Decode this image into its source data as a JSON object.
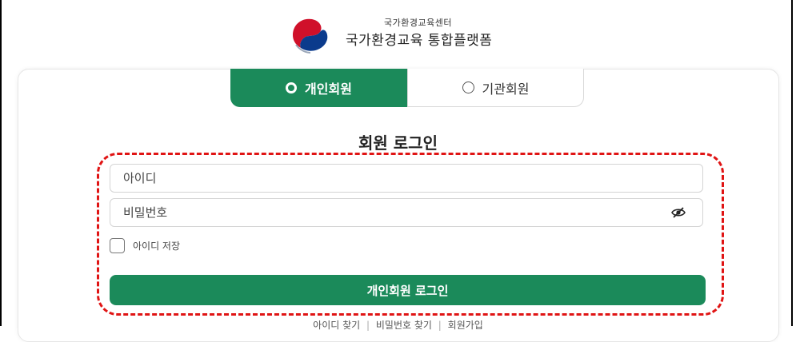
{
  "header": {
    "org_name": "국가환경교육센터",
    "platform_name": "국가환경교육 통합플랫폼",
    "logo_icon": "korean-government-taegeuk-logo",
    "logo_colors": {
      "red": "#d0102a",
      "blue": "#0b3b8c"
    }
  },
  "tabs": [
    {
      "label": "개인회원",
      "selected": true
    },
    {
      "label": "기관회원",
      "selected": false
    }
  ],
  "login": {
    "title": "회원 로그인",
    "id_placeholder": "아이디",
    "pw_placeholder": "비밀번호",
    "show_password_icon": "eye-slash-icon",
    "remember_label": "아이디 저장",
    "remember_checked": false,
    "submit_label": "개인회원 로그인"
  },
  "footer_links": {
    "find_id": "아이디 찾기",
    "find_pw": "비밀번호 찾기",
    "signup": "회원가입",
    "separator": "|"
  },
  "colors": {
    "primary": "#1b8a5a",
    "highlight": "#e01414"
  }
}
